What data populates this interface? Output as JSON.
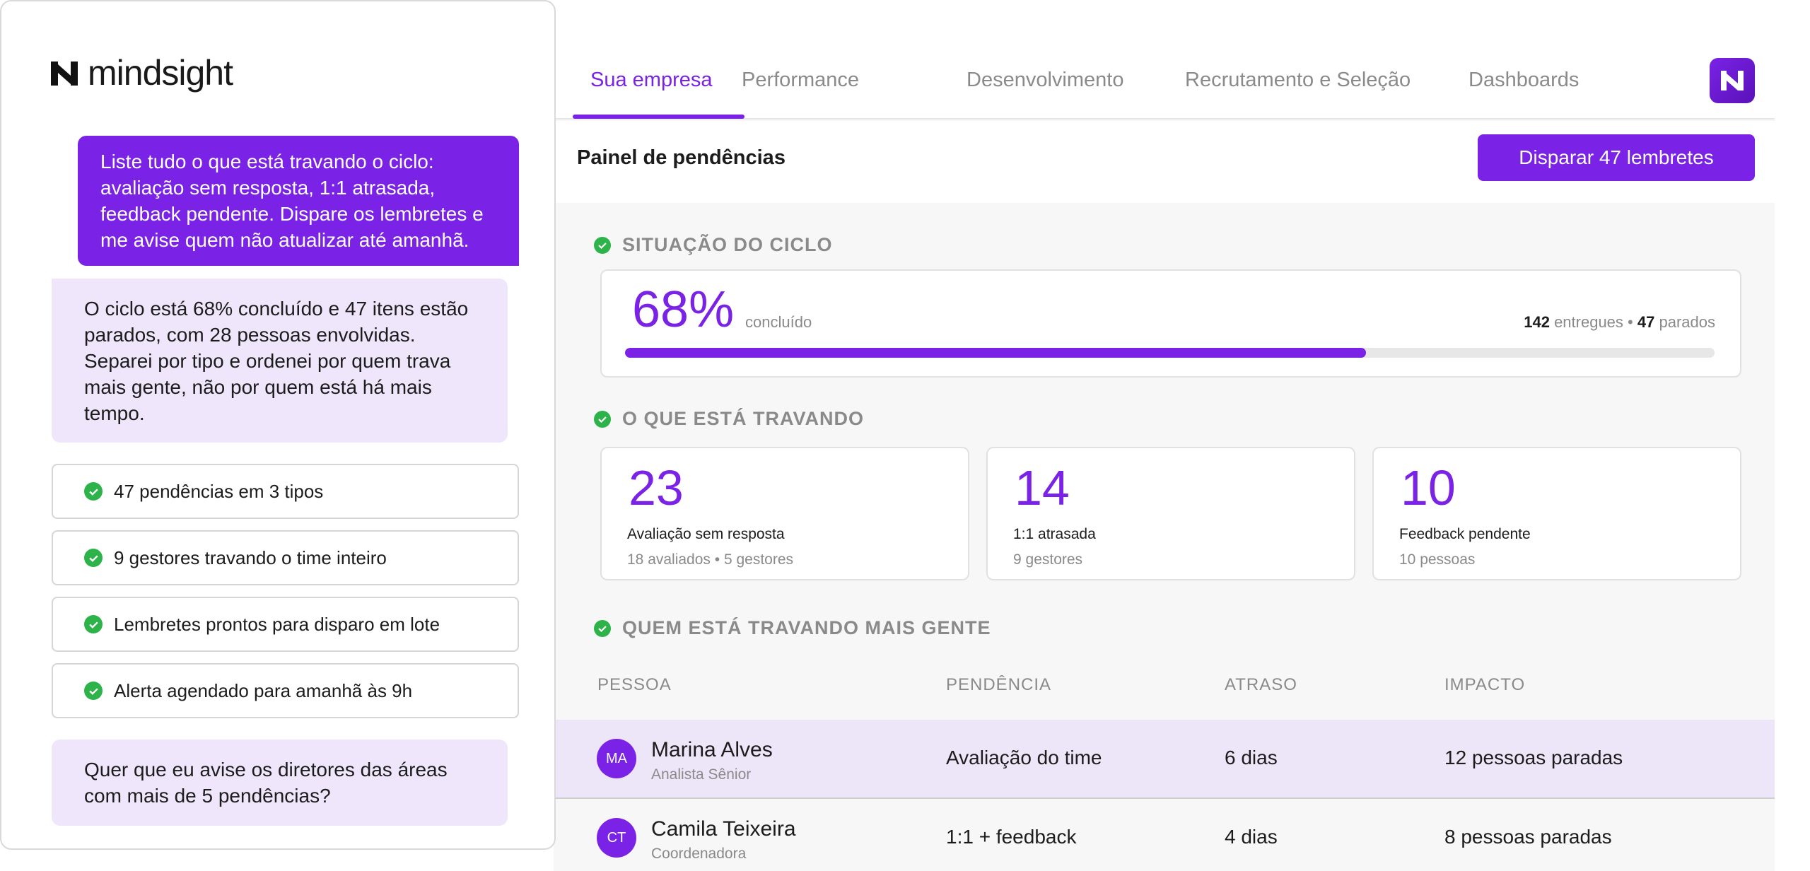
{
  "chat": {
    "logo_text": "mindsight",
    "user_message": "Liste tudo o que está travando o ciclo: avaliação sem resposta, 1:1 atrasada, feedback pendente. Dispare os lembretes e me avise quem não atualizar até amanhã.",
    "ai_message": "O ciclo está 68% concluído e 47 itens estão parados, com 28 pessoas envolvidas. Separei por tipo e ordenei por quem trava mais gente, não por quem está há mais tempo.",
    "checklist": [
      "47 pendências em 3 tipos",
      "9 gestores travando o time inteiro",
      "Lembretes prontos para disparo em lote",
      "Alerta agendado para amanhã às 9h"
    ],
    "ai_question": "Quer que eu avise os diretores das áreas com mais de 5 pendências?"
  },
  "tabs": [
    "Sua empresa",
    "Performance",
    "Desenvolvimento",
    "Recrutamento e Seleção",
    "Dashboards"
  ],
  "active_tab": "Sua empresa",
  "panel": {
    "title": "Painel de pendências",
    "remind_button": "Disparar 47 lembretes"
  },
  "cycle": {
    "section_title": "SITUAÇÃO DO CICLO",
    "percent_text": "68%",
    "percent_label": "concluído",
    "progress_fraction": 0.68,
    "delivered": "142",
    "delivered_label": "entregues",
    "separator": "•",
    "stalled": "47",
    "stalled_label": "parados"
  },
  "blocking": {
    "section_title": "O QUE ESTÁ TRAVANDO",
    "cards": [
      {
        "num": "23",
        "label": "Avaliação sem resposta",
        "sub": "18 avaliados • 5 gestores"
      },
      {
        "num": "14",
        "label": "1:1 atrasada",
        "sub": "9 gestores"
      },
      {
        "num": "10",
        "label": "Feedback pendente",
        "sub": "10 pessoas"
      }
    ]
  },
  "people": {
    "section_title": "QUEM ESTÁ TRAVANDO MAIS GENTE",
    "headers": [
      "PESSOA",
      "PENDÊNCIA",
      "ATRASO",
      "IMPACTO"
    ],
    "rows": [
      {
        "initials": "MA",
        "name": "Marina Alves",
        "role": "Analista Sênior",
        "pending": "Avaliação do time",
        "delay": "6 dias",
        "impact": "12 pessoas paradas"
      },
      {
        "initials": "CT",
        "name": "Camila Teixeira",
        "role": "Coordenadora",
        "pending": "1:1 + feedback",
        "delay": "4 dias",
        "impact": "8 pessoas paradas"
      }
    ]
  },
  "colors": {
    "accent": "#7a22e6",
    "success": "#2db34a",
    "highlight_row": "#ede5f8",
    "bubble": "#efe6fb"
  },
  "icons": {
    "logo": "mindsight-logo-icon",
    "check": "check-circle-icon",
    "app": "mindsight-app-icon"
  }
}
